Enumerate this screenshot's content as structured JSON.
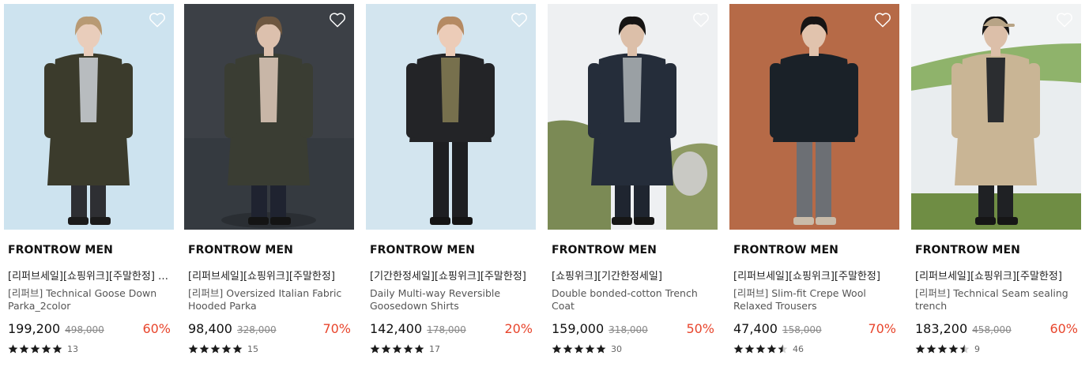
{
  "products": [
    {
      "brand": "FRONTROW MEN",
      "tags": "[리퍼브세일][쇼핑위크][주말한정] 쇼핑위크",
      "name": "[리퍼브] Technical Goose Down Parka_2color",
      "price": "199,200",
      "original_price": "498,000",
      "discount": "60%",
      "rating": 5,
      "review_count": "13",
      "image": {
        "bg": "#cde3ef",
        "coat": "#3b3b2c",
        "shirt": "#b8bcbf",
        "pants": "#2e2f33",
        "shoes": "#1b1b1b",
        "skin": "#e9cdbb",
        "hair": "#b89a74",
        "style": "parka"
      }
    },
    {
      "brand": "FRONTROW MEN",
      "tags": "[리퍼브세일][쇼핑위크][주말한정]",
      "name": "[리퍼브] Oversized Italian Fabric Hooded Parka",
      "price": "98,400",
      "original_price": "328,000",
      "discount": "70%",
      "rating": 5,
      "review_count": "15",
      "image": {
        "bg": "#3c4046",
        "coat": "#3a3d33",
        "shirt": "#c8b6a7",
        "pants": "#1f2330",
        "shoes": "#141414",
        "skin": "#dcc0ad",
        "hair": "#6e5740",
        "style": "long"
      }
    },
    {
      "brand": "FRONTROW MEN",
      "tags": "[기간한정세일][쇼핑위크][주말한정]",
      "name": "Daily Multi-way Reversible Goosedown Shirts",
      "price": "142,400",
      "original_price": "178,000",
      "discount": "20%",
      "rating": 5,
      "review_count": "17",
      "image": {
        "bg": "#d3e5ef",
        "coat": "#232427",
        "shirt": "#77704d",
        "pants": "#1e1f22",
        "shoes": "#141414",
        "skin": "#ecccb8",
        "hair": "#b58a63",
        "style": "jacket"
      }
    },
    {
      "brand": "FRONTROW MEN",
      "tags": "[쇼핑위크][기간한정세일]",
      "name": "Double bonded-cotton Trench Coat",
      "price": "159,000",
      "original_price": "318,000",
      "discount": "50%",
      "rating": 5,
      "review_count": "30",
      "image": {
        "bg": "#eef0f2",
        "coat": "#252d3a",
        "shirt": "#9aa0a4",
        "pants": "#1f2530",
        "shoes": "#161616",
        "skin": "#dcbfa9",
        "hair": "#161413",
        "style": "trench"
      }
    },
    {
      "brand": "FRONTROW MEN",
      "tags": "[리퍼브세일][쇼핑위크][주말한정]",
      "name": "[리퍼브] Slim-fit Crepe Wool Relaxed Trousers",
      "price": "47,400",
      "original_price": "158,000",
      "discount": "70%",
      "rating": 4.5,
      "review_count": "46",
      "image": {
        "bg": "#b66a47",
        "coat": "#1a2128",
        "shirt": "#1a2128",
        "pants": "#6c6f74",
        "shoes": "#c9bba9",
        "skin": "#e1c3ad",
        "hair": "#171414",
        "style": "sweater"
      }
    },
    {
      "brand": "FRONTROW MEN",
      "tags": "[리퍼브세일][쇼핑위크][주말한정]",
      "name": "[리퍼브] Technical Seam sealing trench",
      "price": "183,200",
      "original_price": "458,000",
      "discount": "60%",
      "rating": 4.5,
      "review_count": "9",
      "image": {
        "bg": "#f1f3f4",
        "coat": "#c9b595",
        "shirt": "#2b2d30",
        "pants": "#1f2124",
        "shoes": "#161616",
        "skin": "#dcbfa9",
        "hair": "#161413",
        "style": "trench-cap"
      }
    }
  ],
  "icons": {
    "wishlist": "heart-outline-icon",
    "rating": "star-icon"
  },
  "colors": {
    "discount": "#e8452c",
    "text": "#111111",
    "muted": "#888888",
    "star": "#1a1a1a"
  }
}
